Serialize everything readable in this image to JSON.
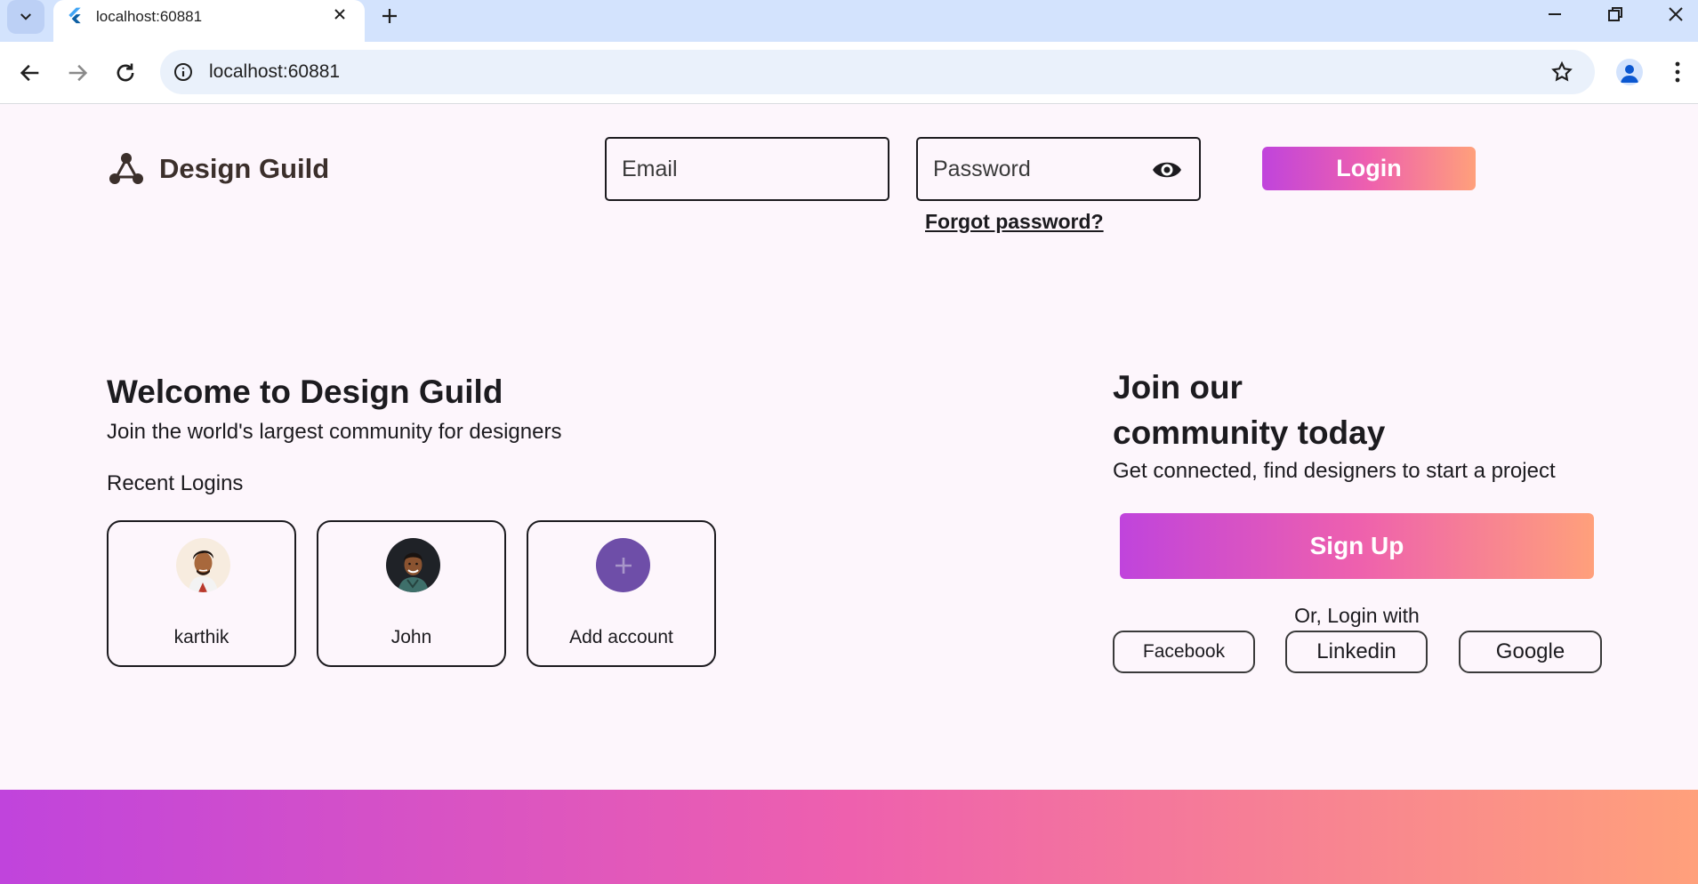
{
  "browser": {
    "tab_title": "localhost:60881",
    "url": "localhost:60881"
  },
  "header": {
    "brand_name": "Design Guild",
    "email_placeholder": "Email",
    "password_placeholder": "Password",
    "forgot_label": "Forgot password?",
    "login_label": "Login"
  },
  "welcome": {
    "title": "Welcome to Design Guild",
    "subtitle": "Join the world's largest community for designers",
    "recent_title": "Recent Logins",
    "accounts": [
      {
        "name": "karthik"
      },
      {
        "name": "John"
      },
      {
        "name": "Add account"
      }
    ]
  },
  "join": {
    "title_line1": "Join our",
    "title_line2": "community today",
    "subtitle": "Get connected, find designers to start a project",
    "signup_label": "Sign Up",
    "or_text": "Or, Login with",
    "socials": [
      "Facebook",
      "Linkedin",
      "Google"
    ]
  },
  "colors": {
    "gradient_start": "#c044dc",
    "gradient_mid": "#ee60ae",
    "gradient_end": "#ffa07b",
    "page_bg": "#fdf6fc",
    "add_account_circle": "#6e4ea8"
  }
}
